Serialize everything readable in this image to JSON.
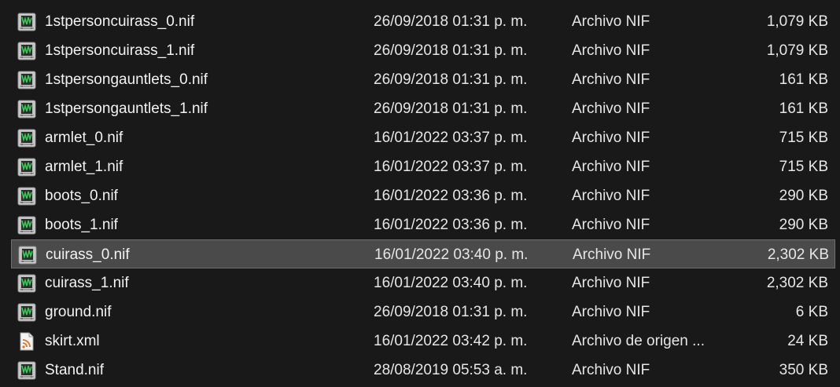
{
  "files": [
    {
      "name": "1stpersoncuirass_0.nif",
      "date": "26/09/2018 01:31 p. m.",
      "type": "Archivo NIF",
      "size": "1,079 KB",
      "icon": "nif-file-icon",
      "selected": false
    },
    {
      "name": "1stpersoncuirass_1.nif",
      "date": "26/09/2018 01:31 p. m.",
      "type": "Archivo NIF",
      "size": "1,079 KB",
      "icon": "nif-file-icon",
      "selected": false
    },
    {
      "name": "1stpersongauntlets_0.nif",
      "date": "26/09/2018 01:31 p. m.",
      "type": "Archivo NIF",
      "size": "161 KB",
      "icon": "nif-file-icon",
      "selected": false
    },
    {
      "name": "1stpersongauntlets_1.nif",
      "date": "26/09/2018 01:31 p. m.",
      "type": "Archivo NIF",
      "size": "161 KB",
      "icon": "nif-file-icon",
      "selected": false
    },
    {
      "name": "armlet_0.nif",
      "date": "16/01/2022 03:37 p. m.",
      "type": "Archivo NIF",
      "size": "715 KB",
      "icon": "nif-file-icon",
      "selected": false
    },
    {
      "name": "armlet_1.nif",
      "date": "16/01/2022 03:37 p. m.",
      "type": "Archivo NIF",
      "size": "715 KB",
      "icon": "nif-file-icon",
      "selected": false
    },
    {
      "name": "boots_0.nif",
      "date": "16/01/2022 03:36 p. m.",
      "type": "Archivo NIF",
      "size": "290 KB",
      "icon": "nif-file-icon",
      "selected": false
    },
    {
      "name": "boots_1.nif",
      "date": "16/01/2022 03:36 p. m.",
      "type": "Archivo NIF",
      "size": "290 KB",
      "icon": "nif-file-icon",
      "selected": false
    },
    {
      "name": "cuirass_0.nif",
      "date": "16/01/2022 03:40 p. m.",
      "type": "Archivo NIF",
      "size": "2,302 KB",
      "icon": "nif-file-icon",
      "selected": true
    },
    {
      "name": "cuirass_1.nif",
      "date": "16/01/2022 03:40 p. m.",
      "type": "Archivo NIF",
      "size": "2,302 KB",
      "icon": "nif-file-icon",
      "selected": false
    },
    {
      "name": "ground.nif",
      "date": "26/09/2018 01:31 p. m.",
      "type": "Archivo NIF",
      "size": "6 KB",
      "icon": "nif-file-icon",
      "selected": false
    },
    {
      "name": "skirt.xml",
      "date": "16/01/2022 03:42 p. m.",
      "type": "Archivo de origen ...",
      "size": "24 KB",
      "icon": "xml-file-icon",
      "selected": false
    },
    {
      "name": "Stand.nif",
      "date": "28/08/2019 05:53 a. m.",
      "type": "Archivo NIF",
      "size": "350 KB",
      "icon": "nif-file-icon",
      "selected": false
    }
  ],
  "colors": {
    "background": "#191919",
    "selection": "#4a4a4a",
    "selection_border": "#6e6e6e",
    "text": "#f2f2f2",
    "xml_icon_accent": "#e8701a"
  }
}
